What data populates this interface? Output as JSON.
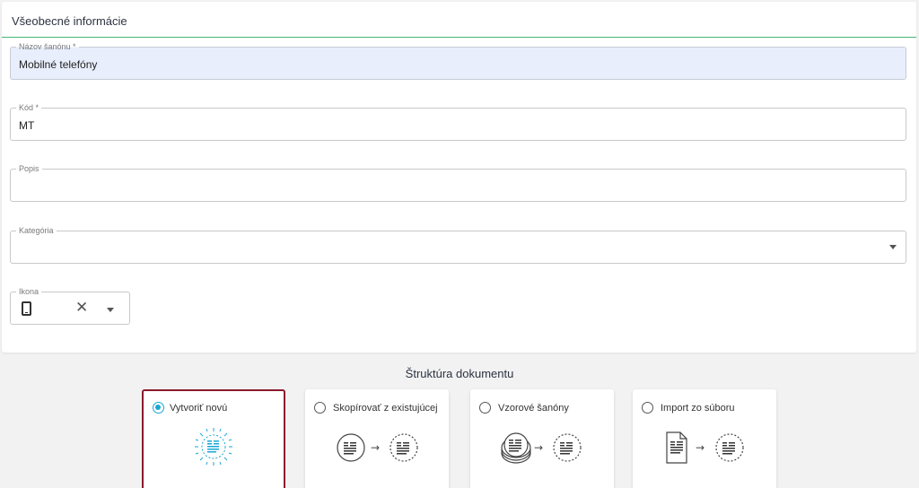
{
  "section": {
    "title": "Všeobecné informácie"
  },
  "fields": {
    "name": {
      "label": "Názov šanónu *",
      "value": "Mobilné telefóny"
    },
    "code": {
      "label": "Kód *",
      "value": "MT"
    },
    "description": {
      "label": "Popis",
      "value": ""
    },
    "category": {
      "label": "Kategória",
      "value": ""
    },
    "icon": {
      "label": "Ikona",
      "selected_icon": "phone-icon",
      "clear_symbol": "✕"
    }
  },
  "structure": {
    "title": "Štruktúra dokumentu",
    "options": [
      {
        "label": "Vytvoriť novú",
        "selected": true,
        "icon": "new-document-icon"
      },
      {
        "label": "Skopírovať z existujúcej",
        "selected": false,
        "icon": "copy-document-icon"
      },
      {
        "label": "Vzorové šanóny",
        "selected": false,
        "icon": "template-binders-icon"
      },
      {
        "label": "Import zo súboru",
        "selected": false,
        "icon": "import-file-icon"
      }
    ]
  },
  "colors": {
    "accent": "#19a7d4",
    "header_line": "#43b873",
    "selected_border": "#8b1a2b",
    "filled_bg": "#e8eefb"
  }
}
